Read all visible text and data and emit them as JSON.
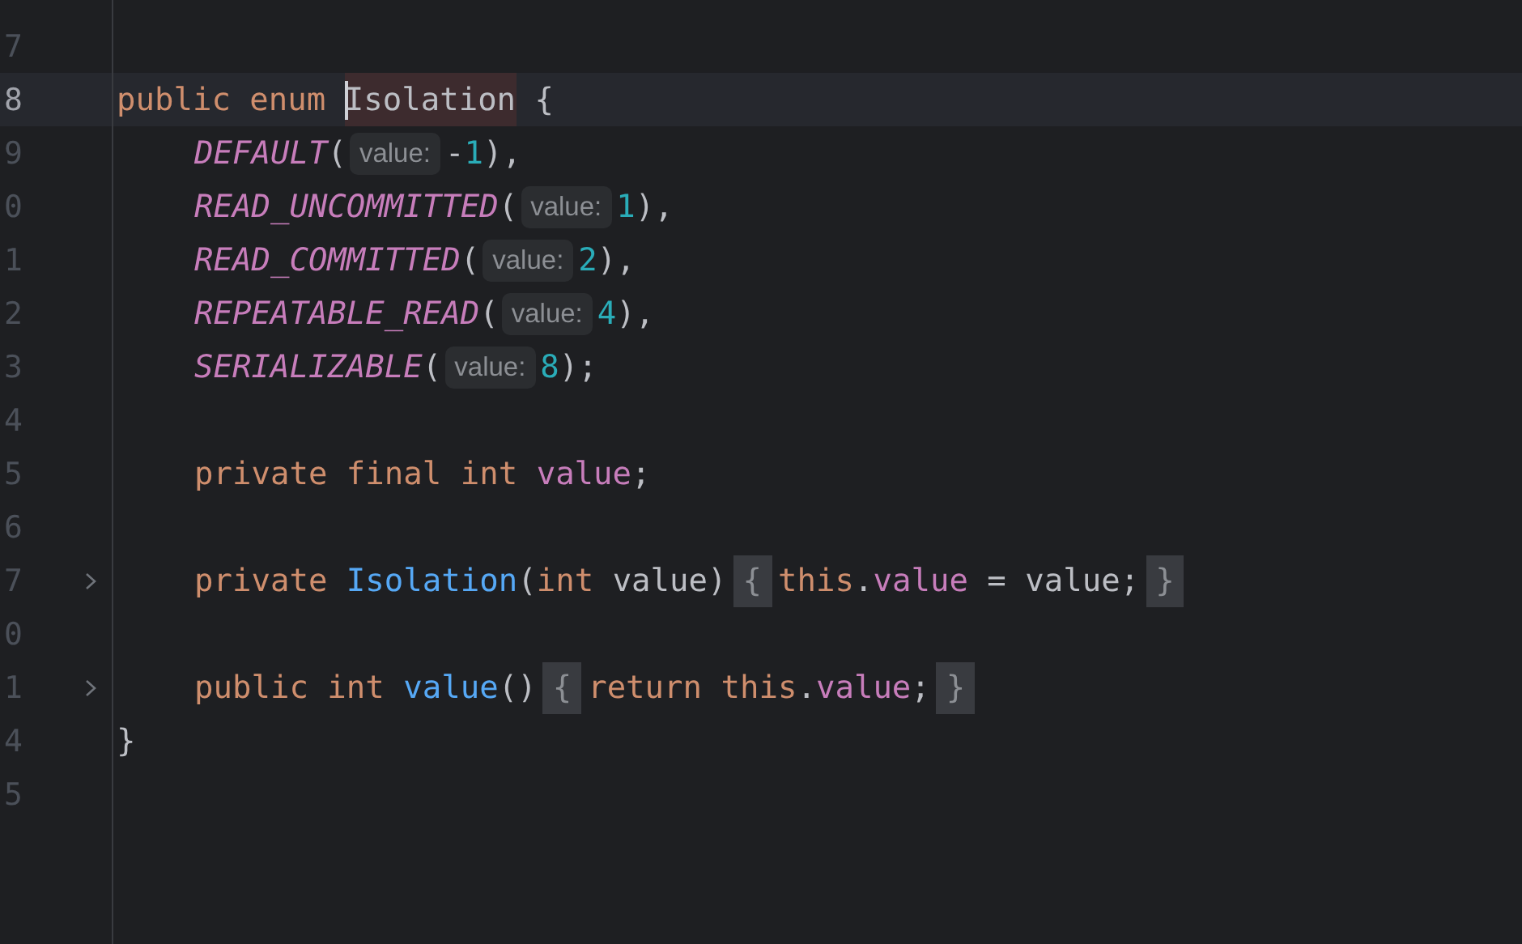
{
  "editor": {
    "lines": [
      {
        "number": "7",
        "current": false,
        "fold": false
      },
      {
        "number": "8",
        "current": true,
        "fold": false,
        "indented": false,
        "tokens": [
          {
            "kind": "keyword",
            "text": "public enum "
          },
          {
            "kind": "highlighted",
            "caret_before": true,
            "text": "Isolation"
          },
          {
            "kind": "plain",
            "text": " {"
          }
        ]
      },
      {
        "number": "9",
        "current": false,
        "fold": false,
        "indented": true,
        "tokens": [
          {
            "kind": "constant",
            "text": "DEFAULT"
          },
          {
            "kind": "plain",
            "text": "("
          },
          {
            "kind": "hint",
            "text": "value:"
          },
          {
            "kind": "plain",
            "text": "-"
          },
          {
            "kind": "number",
            "text": "1"
          },
          {
            "kind": "plain",
            "text": "),"
          }
        ]
      },
      {
        "number": "0",
        "current": false,
        "fold": false,
        "indented": true,
        "tokens": [
          {
            "kind": "constant",
            "text": "READ_UNCOMMITTED"
          },
          {
            "kind": "plain",
            "text": "("
          },
          {
            "kind": "hint",
            "text": "value:"
          },
          {
            "kind": "number",
            "text": "1"
          },
          {
            "kind": "plain",
            "text": "),"
          }
        ]
      },
      {
        "number": "1",
        "current": false,
        "fold": false,
        "indented": true,
        "tokens": [
          {
            "kind": "constant",
            "text": "READ_COMMITTED"
          },
          {
            "kind": "plain",
            "text": "("
          },
          {
            "kind": "hint",
            "text": "value:"
          },
          {
            "kind": "number",
            "text": "2"
          },
          {
            "kind": "plain",
            "text": "),"
          }
        ]
      },
      {
        "number": "2",
        "current": false,
        "fold": false,
        "indented": true,
        "tokens": [
          {
            "kind": "constant",
            "text": "REPEATABLE_READ"
          },
          {
            "kind": "plain",
            "text": "("
          },
          {
            "kind": "hint",
            "text": "value:"
          },
          {
            "kind": "number",
            "text": "4"
          },
          {
            "kind": "plain",
            "text": "),"
          }
        ]
      },
      {
        "number": "3",
        "current": false,
        "fold": false,
        "indented": true,
        "tokens": [
          {
            "kind": "constant",
            "text": "SERIALIZABLE"
          },
          {
            "kind": "plain",
            "text": "("
          },
          {
            "kind": "hint",
            "text": "value:"
          },
          {
            "kind": "number",
            "text": "8"
          },
          {
            "kind": "plain",
            "text": ");"
          }
        ]
      },
      {
        "number": "4",
        "current": false,
        "fold": false
      },
      {
        "number": "5",
        "current": false,
        "fold": false,
        "indented": true,
        "tokens": [
          {
            "kind": "keyword",
            "text": "private final int "
          },
          {
            "kind": "field",
            "text": "value"
          },
          {
            "kind": "plain",
            "text": ";"
          }
        ]
      },
      {
        "number": "6",
        "current": false,
        "fold": false
      },
      {
        "number": "7",
        "current": false,
        "fold": true,
        "indented": true,
        "tokens": [
          {
            "kind": "keyword",
            "text": "private "
          },
          {
            "kind": "method",
            "text": "Isolation"
          },
          {
            "kind": "plain",
            "text": "("
          },
          {
            "kind": "keyword",
            "text": "int "
          },
          {
            "kind": "plain",
            "text": "value)"
          },
          {
            "kind": "fold",
            "text": "{"
          },
          {
            "kind": "keyword",
            "text": "this"
          },
          {
            "kind": "plain",
            "text": "."
          },
          {
            "kind": "field",
            "text": "value"
          },
          {
            "kind": "plain",
            "text": " = value;"
          },
          {
            "kind": "fold",
            "text": "}"
          }
        ]
      },
      {
        "number": "0",
        "current": false,
        "fold": false
      },
      {
        "number": "1",
        "current": false,
        "fold": true,
        "indented": true,
        "tokens": [
          {
            "kind": "keyword",
            "text": "public int "
          },
          {
            "kind": "method",
            "text": "value"
          },
          {
            "kind": "plain",
            "text": "()"
          },
          {
            "kind": "fold",
            "text": "{"
          },
          {
            "kind": "keyword",
            "text": "return this"
          },
          {
            "kind": "plain",
            "text": "."
          },
          {
            "kind": "field",
            "text": "value"
          },
          {
            "kind": "plain",
            "text": ";"
          },
          {
            "kind": "fold",
            "text": "}"
          }
        ]
      },
      {
        "number": "4",
        "current": false,
        "fold": false,
        "indented": false,
        "tokens": [
          {
            "kind": "plain",
            "text": "}"
          }
        ]
      },
      {
        "number": "5",
        "current": false,
        "fold": false
      }
    ]
  }
}
